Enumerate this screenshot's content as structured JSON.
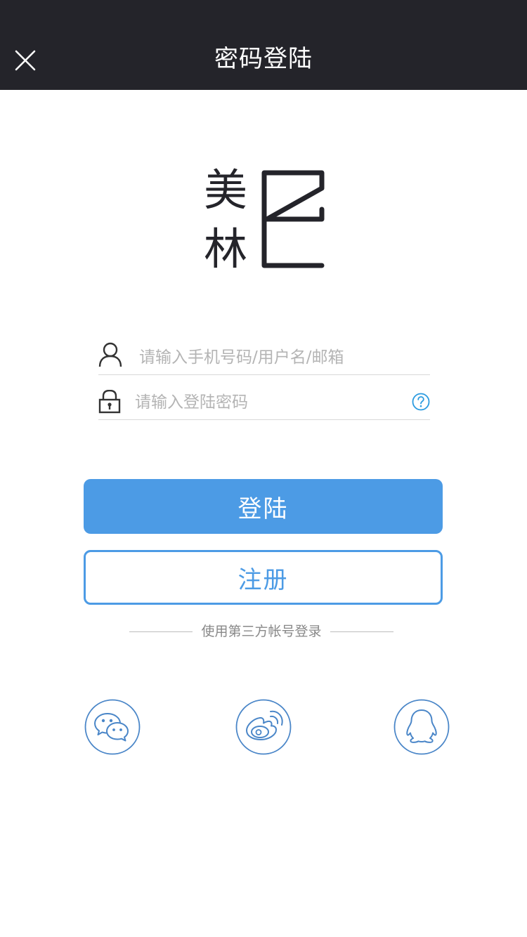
{
  "header": {
    "title": "密码登陆",
    "close_icon": "close-icon"
  },
  "logo": {
    "char_top": "美",
    "char_bottom": "林",
    "mark_icon": "brand-mark-icon"
  },
  "form": {
    "username": {
      "placeholder": "请输入手机号码/用户名/邮箱",
      "value": "",
      "icon": "user-icon"
    },
    "password": {
      "placeholder": "请输入登陆密码",
      "value": "",
      "icon": "lock-icon",
      "help_icon": "help-icon"
    }
  },
  "buttons": {
    "login_label": "登陆",
    "register_label": "注册"
  },
  "third_party": {
    "label": "使用第三方帐号登录",
    "providers": [
      "wechat-icon",
      "weibo-icon",
      "qq-icon"
    ]
  },
  "colors": {
    "header_bg": "#24242a",
    "accent": "#4c9be5",
    "social_stroke": "#4a86c8",
    "help": "#2b9be0"
  }
}
